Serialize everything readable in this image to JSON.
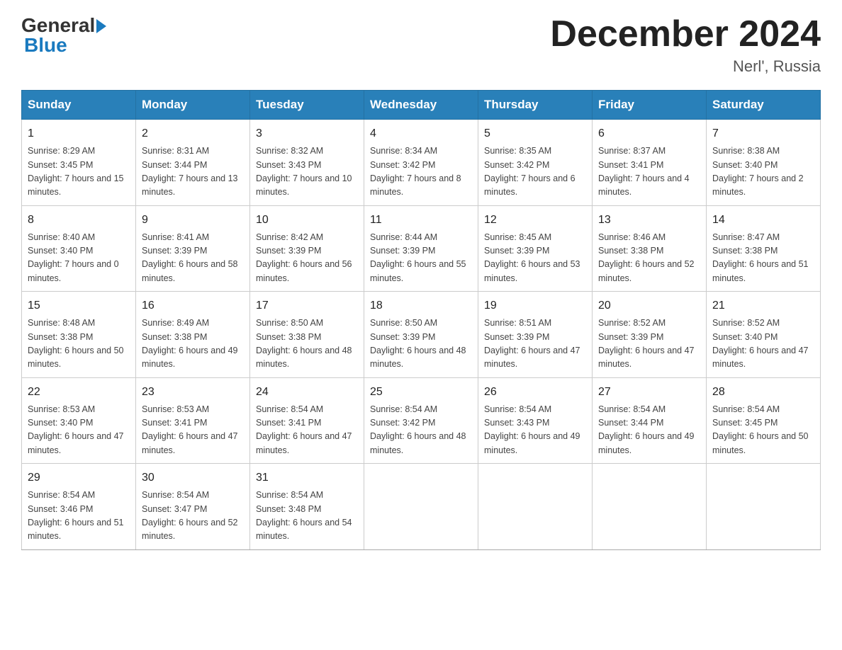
{
  "header": {
    "logo_general": "General",
    "logo_blue": "Blue",
    "month_title": "December 2024",
    "location": "Nerl', Russia"
  },
  "weekdays": [
    "Sunday",
    "Monday",
    "Tuesday",
    "Wednesday",
    "Thursday",
    "Friday",
    "Saturday"
  ],
  "weeks": [
    [
      {
        "day": "1",
        "sunrise": "8:29 AM",
        "sunset": "3:45 PM",
        "daylight": "7 hours and 15 minutes."
      },
      {
        "day": "2",
        "sunrise": "8:31 AM",
        "sunset": "3:44 PM",
        "daylight": "7 hours and 13 minutes."
      },
      {
        "day": "3",
        "sunrise": "8:32 AM",
        "sunset": "3:43 PM",
        "daylight": "7 hours and 10 minutes."
      },
      {
        "day": "4",
        "sunrise": "8:34 AM",
        "sunset": "3:42 PM",
        "daylight": "7 hours and 8 minutes."
      },
      {
        "day": "5",
        "sunrise": "8:35 AM",
        "sunset": "3:42 PM",
        "daylight": "7 hours and 6 minutes."
      },
      {
        "day": "6",
        "sunrise": "8:37 AM",
        "sunset": "3:41 PM",
        "daylight": "7 hours and 4 minutes."
      },
      {
        "day": "7",
        "sunrise": "8:38 AM",
        "sunset": "3:40 PM",
        "daylight": "7 hours and 2 minutes."
      }
    ],
    [
      {
        "day": "8",
        "sunrise": "8:40 AM",
        "sunset": "3:40 PM",
        "daylight": "7 hours and 0 minutes."
      },
      {
        "day": "9",
        "sunrise": "8:41 AM",
        "sunset": "3:39 PM",
        "daylight": "6 hours and 58 minutes."
      },
      {
        "day": "10",
        "sunrise": "8:42 AM",
        "sunset": "3:39 PM",
        "daylight": "6 hours and 56 minutes."
      },
      {
        "day": "11",
        "sunrise": "8:44 AM",
        "sunset": "3:39 PM",
        "daylight": "6 hours and 55 minutes."
      },
      {
        "day": "12",
        "sunrise": "8:45 AM",
        "sunset": "3:39 PM",
        "daylight": "6 hours and 53 minutes."
      },
      {
        "day": "13",
        "sunrise": "8:46 AM",
        "sunset": "3:38 PM",
        "daylight": "6 hours and 52 minutes."
      },
      {
        "day": "14",
        "sunrise": "8:47 AM",
        "sunset": "3:38 PM",
        "daylight": "6 hours and 51 minutes."
      }
    ],
    [
      {
        "day": "15",
        "sunrise": "8:48 AM",
        "sunset": "3:38 PM",
        "daylight": "6 hours and 50 minutes."
      },
      {
        "day": "16",
        "sunrise": "8:49 AM",
        "sunset": "3:38 PM",
        "daylight": "6 hours and 49 minutes."
      },
      {
        "day": "17",
        "sunrise": "8:50 AM",
        "sunset": "3:38 PM",
        "daylight": "6 hours and 48 minutes."
      },
      {
        "day": "18",
        "sunrise": "8:50 AM",
        "sunset": "3:39 PM",
        "daylight": "6 hours and 48 minutes."
      },
      {
        "day": "19",
        "sunrise": "8:51 AM",
        "sunset": "3:39 PM",
        "daylight": "6 hours and 47 minutes."
      },
      {
        "day": "20",
        "sunrise": "8:52 AM",
        "sunset": "3:39 PM",
        "daylight": "6 hours and 47 minutes."
      },
      {
        "day": "21",
        "sunrise": "8:52 AM",
        "sunset": "3:40 PM",
        "daylight": "6 hours and 47 minutes."
      }
    ],
    [
      {
        "day": "22",
        "sunrise": "8:53 AM",
        "sunset": "3:40 PM",
        "daylight": "6 hours and 47 minutes."
      },
      {
        "day": "23",
        "sunrise": "8:53 AM",
        "sunset": "3:41 PM",
        "daylight": "6 hours and 47 minutes."
      },
      {
        "day": "24",
        "sunrise": "8:54 AM",
        "sunset": "3:41 PM",
        "daylight": "6 hours and 47 minutes."
      },
      {
        "day": "25",
        "sunrise": "8:54 AM",
        "sunset": "3:42 PM",
        "daylight": "6 hours and 48 minutes."
      },
      {
        "day": "26",
        "sunrise": "8:54 AM",
        "sunset": "3:43 PM",
        "daylight": "6 hours and 49 minutes."
      },
      {
        "day": "27",
        "sunrise": "8:54 AM",
        "sunset": "3:44 PM",
        "daylight": "6 hours and 49 minutes."
      },
      {
        "day": "28",
        "sunrise": "8:54 AM",
        "sunset": "3:45 PM",
        "daylight": "6 hours and 50 minutes."
      }
    ],
    [
      {
        "day": "29",
        "sunrise": "8:54 AM",
        "sunset": "3:46 PM",
        "daylight": "6 hours and 51 minutes."
      },
      {
        "day": "30",
        "sunrise": "8:54 AM",
        "sunset": "3:47 PM",
        "daylight": "6 hours and 52 minutes."
      },
      {
        "day": "31",
        "sunrise": "8:54 AM",
        "sunset": "3:48 PM",
        "daylight": "6 hours and 54 minutes."
      },
      null,
      null,
      null,
      null
    ]
  ]
}
